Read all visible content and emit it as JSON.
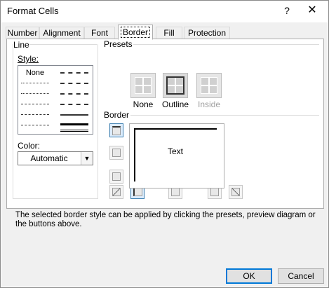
{
  "window": {
    "title": "Format Cells",
    "help": "?",
    "close": "✕"
  },
  "tabs": [
    "Number",
    "Alignment",
    "Font",
    "Border",
    "Fill",
    "Protection"
  ],
  "line": {
    "group_label": "Line",
    "style_label": "Style:",
    "none_label": "None",
    "color_label": "Color:",
    "color_value": "Automatic"
  },
  "presets": {
    "group_label": "Presets",
    "items": [
      "None",
      "Outline",
      "Inside"
    ]
  },
  "border": {
    "group_label": "Border",
    "preview_text": "Text"
  },
  "description": "The selected border style can be applied by clicking the presets, preview diagram or the buttons above.",
  "buttons": {
    "ok": "OK",
    "cancel": "Cancel"
  },
  "colors": {
    "accent": "#0078d7",
    "selected_bg": "#dcecfc"
  }
}
